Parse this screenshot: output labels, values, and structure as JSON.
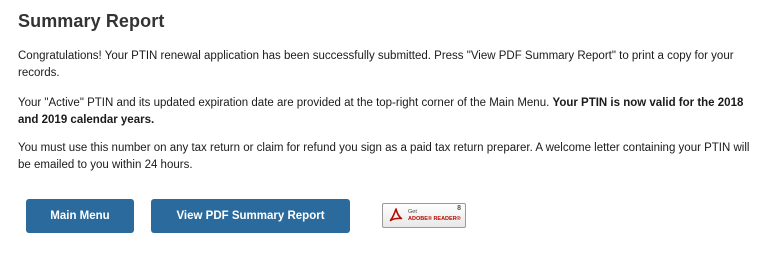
{
  "page": {
    "title": "Summary Report"
  },
  "content": {
    "paragraph1": "Congratulations! Your PTIN renewal application has been successfully submitted. Press \"View PDF Summary Report\" to print a copy for your records.",
    "paragraph2_plain": "Your \"Active\" PTIN and its updated expiration date are provided at the top-right corner of the Main Menu. ",
    "paragraph2_bold": "Your PTIN is now valid for the 2018 and 2019 calendar years.",
    "paragraph3": "You must use this number on any tax return or claim for refund you sign as a paid tax return preparer. A welcome letter containing your PTIN will be emailed to you within 24 hours."
  },
  "actions": {
    "main_menu_label": "Main Menu",
    "view_pdf_label": "View PDF Summary Report"
  },
  "adobe_badge": {
    "get_text": "Get",
    "name_text": "ADOBE® READER®",
    "version": "8",
    "icon": "adobe-pdf-icon"
  },
  "colors": {
    "button_background": "#2b6a9c",
    "button_text": "#ffffff",
    "adobe_red": "#b30b00"
  }
}
